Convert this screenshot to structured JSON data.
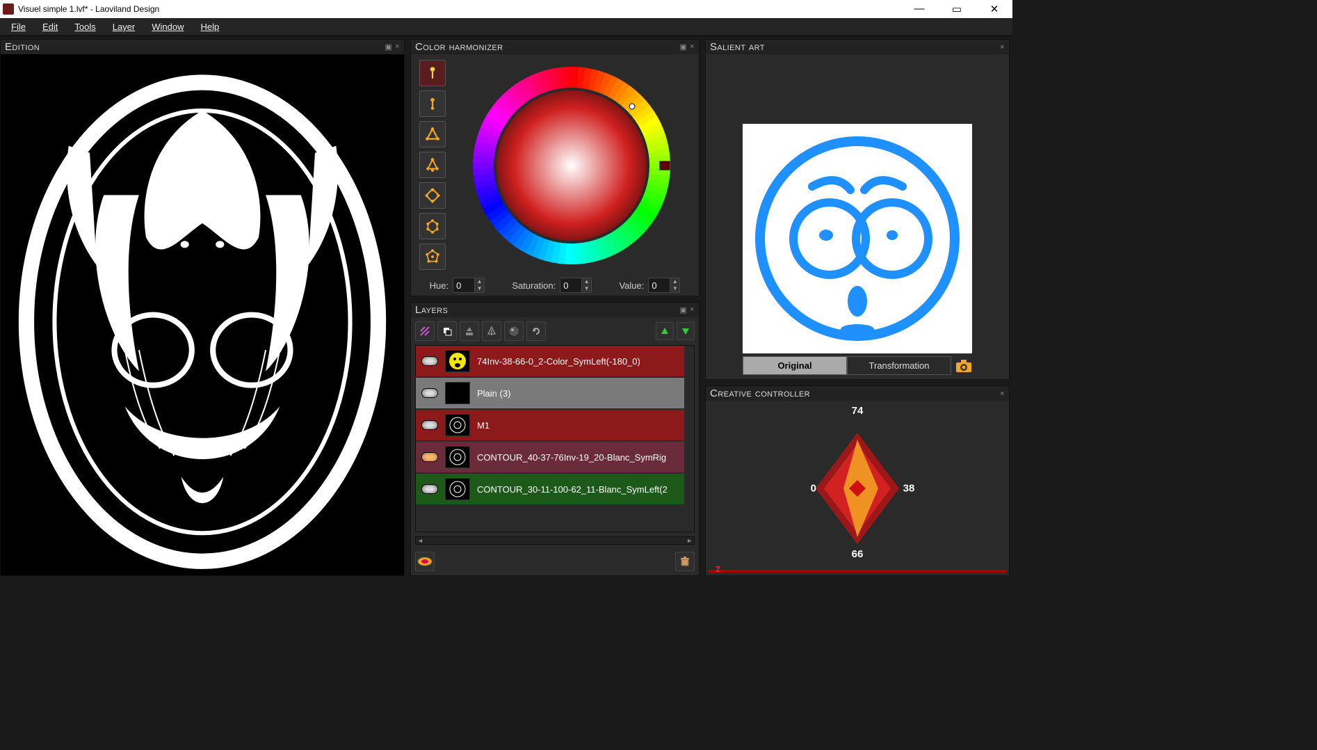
{
  "window": {
    "title": "Visuel simple 1.lvf* - Laoviland Design",
    "minimize": "—",
    "maximize": "▭",
    "close": "✕"
  },
  "menu": [
    "File",
    "Edit",
    "Tools",
    "Layer",
    "Window",
    "Help"
  ],
  "panels": {
    "edition": "Edition",
    "harmonizer": "Color harmonizer",
    "layers": "Layers",
    "salient": "Salient art",
    "creative": "Creative controller"
  },
  "harmonizer": {
    "modes": [
      "monotone",
      "complementary",
      "triad",
      "split",
      "square",
      "analogous",
      "custom"
    ],
    "selected_mode_index": 0,
    "hue_label": "Hue:",
    "hue_value": "0",
    "sat_label": "Saturation:",
    "sat_value": "0",
    "val_label": "Value:",
    "val_value": "0"
  },
  "layers": {
    "toolbar_icons": [
      "hatch",
      "copy",
      "merge-down",
      "flatten",
      "fx",
      "reset"
    ],
    "arrow_up": "▲",
    "arrow_down": "▼",
    "items": [
      {
        "name": "74Inv-38-66-0_2-Color_SymLeft(-180_0)",
        "bg": "#8c1a1a",
        "thumb": "yellow-face",
        "selected": false
      },
      {
        "name": "Plain (3)",
        "bg": "#7a7a7a",
        "thumb": "black",
        "selected": true
      },
      {
        "name": "M1",
        "bg": "#8c1a1a",
        "thumb": "motif1",
        "selected": false
      },
      {
        "name": "CONTOUR_40-37-76Inv-19_20-Blanc_SymRig",
        "bg": "#6b2b3a",
        "thumb": "motif2",
        "selected": false,
        "vis": "green"
      },
      {
        "name": "CONTOUR_30-11-100-62_11-Blanc_SymLeft(2",
        "bg": "#1d5a1a",
        "thumb": "motif3",
        "selected": false
      }
    ]
  },
  "salient": {
    "tab_original": "Original",
    "tab_transformation": "Transformation",
    "active_tab": "original",
    "camera_icon_color": "#f5a623"
  },
  "creative": {
    "top": "74",
    "left": "0",
    "right": "38",
    "bottom": "66",
    "slider_value": "2"
  },
  "icons": {
    "trash": "trash-icon",
    "camera": "camera-icon",
    "lozenge": "lozenge-icon"
  }
}
